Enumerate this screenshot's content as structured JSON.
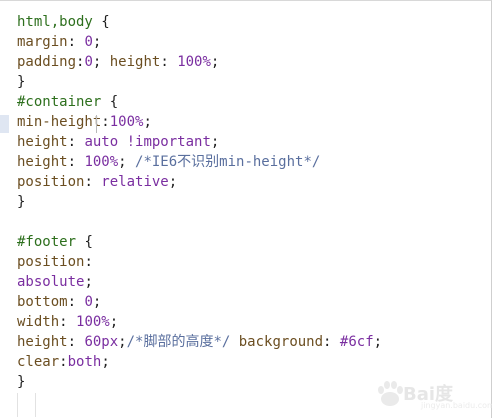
{
  "colors": {
    "selector": "#2d6f1d",
    "property": "#6b4e21",
    "value": "#7a2ea0",
    "comment": "#5a6f9e",
    "punctuation": "#1f1f1f"
  },
  "watermark": {
    "brand": "Bai度",
    "sub": "jingyan.baidu.com"
  },
  "code_lines": [
    [
      {
        "t": "selector",
        "v": "html,body "
      },
      {
        "t": "brace",
        "v": "{"
      }
    ],
    [
      {
        "t": "prop",
        "v": "margin"
      },
      {
        "t": "punct",
        "v": ": "
      },
      {
        "t": "number",
        "v": "0"
      },
      {
        "t": "punct",
        "v": ";"
      }
    ],
    [
      {
        "t": "prop",
        "v": "padding"
      },
      {
        "t": "punct",
        "v": ":"
      },
      {
        "t": "number",
        "v": "0"
      },
      {
        "t": "punct",
        "v": "; "
      },
      {
        "t": "prop",
        "v": "height"
      },
      {
        "t": "punct",
        "v": ": "
      },
      {
        "t": "number",
        "v": "100%"
      },
      {
        "t": "punct",
        "v": ";"
      }
    ],
    [
      {
        "t": "brace",
        "v": "}"
      }
    ],
    [
      {
        "t": "selector",
        "v": "#container "
      },
      {
        "t": "brace",
        "v": "{"
      }
    ],
    [
      {
        "t": "prop",
        "v": "min-height"
      },
      {
        "t": "punct",
        "v": ":"
      },
      {
        "t": "number",
        "v": "100%"
      },
      {
        "t": "punct",
        "v": ";"
      }
    ],
    [
      {
        "t": "prop",
        "v": "height"
      },
      {
        "t": "punct",
        "v": ": "
      },
      {
        "t": "value",
        "v": "auto"
      },
      {
        "t": "punct",
        "v": " "
      },
      {
        "t": "important",
        "v": "!important"
      },
      {
        "t": "punct",
        "v": ";"
      }
    ],
    [
      {
        "t": "prop",
        "v": "height"
      },
      {
        "t": "punct",
        "v": ": "
      },
      {
        "t": "number",
        "v": "100%"
      },
      {
        "t": "punct",
        "v": "; "
      },
      {
        "t": "comment",
        "v": "/*IE6不识别min-height*/"
      }
    ],
    [
      {
        "t": "prop",
        "v": "position"
      },
      {
        "t": "punct",
        "v": ": "
      },
      {
        "t": "value",
        "v": "relative"
      },
      {
        "t": "punct",
        "v": ";"
      }
    ],
    [
      {
        "t": "brace",
        "v": "}"
      }
    ],
    [],
    [
      {
        "t": "selector",
        "v": "#footer "
      },
      {
        "t": "brace",
        "v": "{"
      }
    ],
    [
      {
        "t": "prop",
        "v": "position"
      },
      {
        "t": "punct",
        "v": ":"
      }
    ],
    [
      {
        "t": "value",
        "v": "absolute"
      },
      {
        "t": "punct",
        "v": ";"
      }
    ],
    [
      {
        "t": "prop",
        "v": "bottom"
      },
      {
        "t": "punct",
        "v": ": "
      },
      {
        "t": "number",
        "v": "0"
      },
      {
        "t": "punct",
        "v": ";"
      }
    ],
    [
      {
        "t": "prop",
        "v": "width"
      },
      {
        "t": "punct",
        "v": ": "
      },
      {
        "t": "number",
        "v": "100%"
      },
      {
        "t": "punct",
        "v": ";"
      }
    ],
    [
      {
        "t": "prop",
        "v": "height"
      },
      {
        "t": "punct",
        "v": ": "
      },
      {
        "t": "number",
        "v": "60px"
      },
      {
        "t": "punct",
        "v": ";"
      },
      {
        "t": "comment",
        "v": "/*脚部的高度*/"
      },
      {
        "t": "punct",
        "v": " "
      },
      {
        "t": "prop",
        "v": "background"
      },
      {
        "t": "punct",
        "v": ": "
      },
      {
        "t": "value",
        "v": "#6cf"
      },
      {
        "t": "punct",
        "v": ";"
      }
    ],
    [
      {
        "t": "prop",
        "v": "clear"
      },
      {
        "t": "punct",
        "v": ":"
      },
      {
        "t": "value",
        "v": "both"
      },
      {
        "t": "punct",
        "v": ";"
      }
    ],
    [
      {
        "t": "brace",
        "v": "}"
      }
    ]
  ]
}
